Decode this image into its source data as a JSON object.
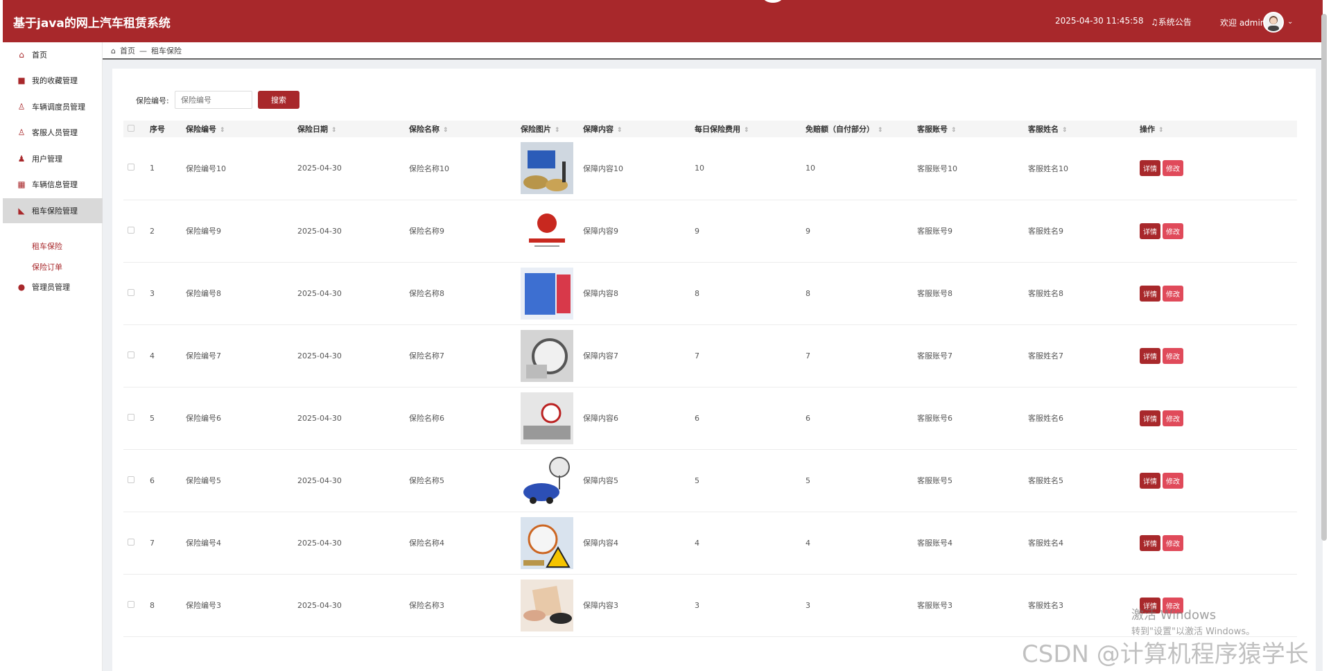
{
  "header": {
    "title": "基于java的网上汽车租赁系统",
    "datetime": "2025-04-30 11:45:58",
    "notice": "系统公告",
    "welcome": "欢迎 admin"
  },
  "sidebar": {
    "items": [
      {
        "label": "首页",
        "icon": "home-icon"
      },
      {
        "label": "我的收藏管理",
        "icon": "favorite-icon"
      },
      {
        "label": "车辆调度员管理",
        "icon": "user-icon"
      },
      {
        "label": "客服人员管理",
        "icon": "user-icon"
      },
      {
        "label": "用户管理",
        "icon": "user-icon"
      },
      {
        "label": "车辆信息管理",
        "icon": "grid-icon"
      },
      {
        "label": "租车保险管理",
        "icon": "insurance-icon"
      },
      {
        "label": "管理员管理",
        "icon": "admin-icon"
      }
    ],
    "subitems": [
      "租车保险",
      "保险订单"
    ]
  },
  "breadcrumb": {
    "home": "首页",
    "separator": "—",
    "current": "租车保险"
  },
  "search": {
    "label": "保险编号:",
    "placeholder": "保险编号",
    "button": "搜索"
  },
  "table": {
    "headers": [
      "序号",
      "保险编号",
      "保险日期",
      "保险名称",
      "保险图片",
      "保障内容",
      "每日保险费用",
      "免赔额（自付部分）",
      "客服账号",
      "客服姓名",
      "操作"
    ],
    "rows": [
      {
        "no": "1",
        "code": "保险编号10",
        "date": "2025-04-30",
        "name": "保险名称10",
        "content": "保障内容10",
        "fee": "10",
        "deductible": "10",
        "account": "客服账号10",
        "staff": "客服姓名10"
      },
      {
        "no": "2",
        "code": "保险编号9",
        "date": "2025-04-30",
        "name": "保险名称9",
        "content": "保障内容9",
        "fee": "9",
        "deductible": "9",
        "account": "客服账号9",
        "staff": "客服姓名9"
      },
      {
        "no": "3",
        "code": "保险编号8",
        "date": "2025-04-30",
        "name": "保险名称8",
        "content": "保障内容8",
        "fee": "8",
        "deductible": "8",
        "account": "客服账号8",
        "staff": "客服姓名8"
      },
      {
        "no": "4",
        "code": "保险编号7",
        "date": "2025-04-30",
        "name": "保险名称7",
        "content": "保障内容7",
        "fee": "7",
        "deductible": "7",
        "account": "客服账号7",
        "staff": "客服姓名7"
      },
      {
        "no": "5",
        "code": "保险编号6",
        "date": "2025-04-30",
        "name": "保险名称6",
        "content": "保障内容6",
        "fee": "6",
        "deductible": "6",
        "account": "客服账号6",
        "staff": "客服姓名6"
      },
      {
        "no": "6",
        "code": "保险编号5",
        "date": "2025-04-30",
        "name": "保险名称5",
        "content": "保障内容5",
        "fee": "5",
        "deductible": "5",
        "account": "客服账号5",
        "staff": "客服姓名5"
      },
      {
        "no": "7",
        "code": "保险编号4",
        "date": "2025-04-30",
        "name": "保险名称4",
        "content": "保障内容4",
        "fee": "4",
        "deductible": "4",
        "account": "客服账号4",
        "staff": "客服姓名4"
      },
      {
        "no": "8",
        "code": "保险编号3",
        "date": "2025-04-30",
        "name": "保险名称3",
        "content": "保障内容3",
        "fee": "3",
        "deductible": "3",
        "account": "客服账号3",
        "staff": "客服姓名3"
      }
    ],
    "actions": {
      "detail": "详情",
      "edit": "修改"
    }
  },
  "watermark": {
    "activate": "激活 Windows",
    "activate_hint": "转到\"设置\"以激活 Windows。",
    "csdn": "CSDN @计算机程序猿学长"
  },
  "colors": {
    "primary": "#a8282b",
    "edit": "#e04a5a"
  }
}
